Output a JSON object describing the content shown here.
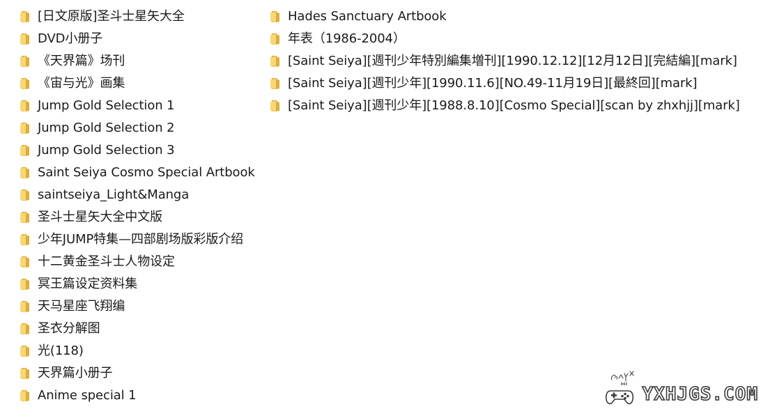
{
  "colors": {
    "folder_light": "#f8d775",
    "folder_dark": "#dcae3a",
    "text": "#1a1a1a"
  },
  "left_column": [
    {
      "label": "[日文原版]圣斗士星矢大全",
      "icon": "folder-icon"
    },
    {
      "label": "DVD小册子",
      "icon": "folder-icon"
    },
    {
      "label": "《天界篇》场刊",
      "icon": "folder-icon"
    },
    {
      "label": "《宙与光》画集",
      "icon": "folder-icon"
    },
    {
      "label": "Jump Gold Selection 1",
      "icon": "folder-icon"
    },
    {
      "label": "Jump Gold Selection 2",
      "icon": "folder-icon"
    },
    {
      "label": "Jump Gold Selection 3",
      "icon": "folder-icon"
    },
    {
      "label": "Saint Seiya Cosmo Special Artbook",
      "icon": "folder-icon"
    },
    {
      "label": "saintseiya_Light&Manga",
      "icon": "folder-icon"
    },
    {
      "label": "圣斗士星矢大全中文版",
      "icon": "folder-icon"
    },
    {
      "label": "少年JUMP特集—四部剧场版彩版介绍",
      "icon": "folder-icon"
    },
    {
      "label": "十二黄金圣斗士人物设定",
      "icon": "folder-icon"
    },
    {
      "label": "冥王篇设定资料集",
      "icon": "folder-icon"
    },
    {
      "label": "天马星座飞翔编",
      "icon": "folder-icon"
    },
    {
      "label": "圣衣分解图",
      "icon": "folder-icon"
    },
    {
      "label": "光(118)",
      "icon": "folder-icon"
    },
    {
      "label": "天界篇小册子",
      "icon": "folder-icon"
    },
    {
      "label": "Anime special 1",
      "icon": "folder-icon"
    }
  ],
  "right_column": [
    {
      "label": "Hades Sanctuary Artbook",
      "icon": "folder-icon"
    },
    {
      "label": "年表（1986-2004）",
      "icon": "folder-icon"
    },
    {
      "label": "[Saint Seiya][週刊少年特別編集増刊][1990.12.12][12月12日][完結編][mark]",
      "icon": "folder-icon"
    },
    {
      "label": "[Saint Seiya][週刊少年][1990.11.6][NO.49-11月19日][最終回][mark]",
      "icon": "folder-icon"
    },
    {
      "label": "[Saint Seiya][週刊少年][1988.8.10][Cosmo Special][scan by zhxhjj][mark]",
      "icon": "folder-icon"
    }
  ],
  "watermark": {
    "text": "YXHJGS.COM",
    "handwriting": "GSYX HJ",
    "icon": "gamepad-icon"
  }
}
